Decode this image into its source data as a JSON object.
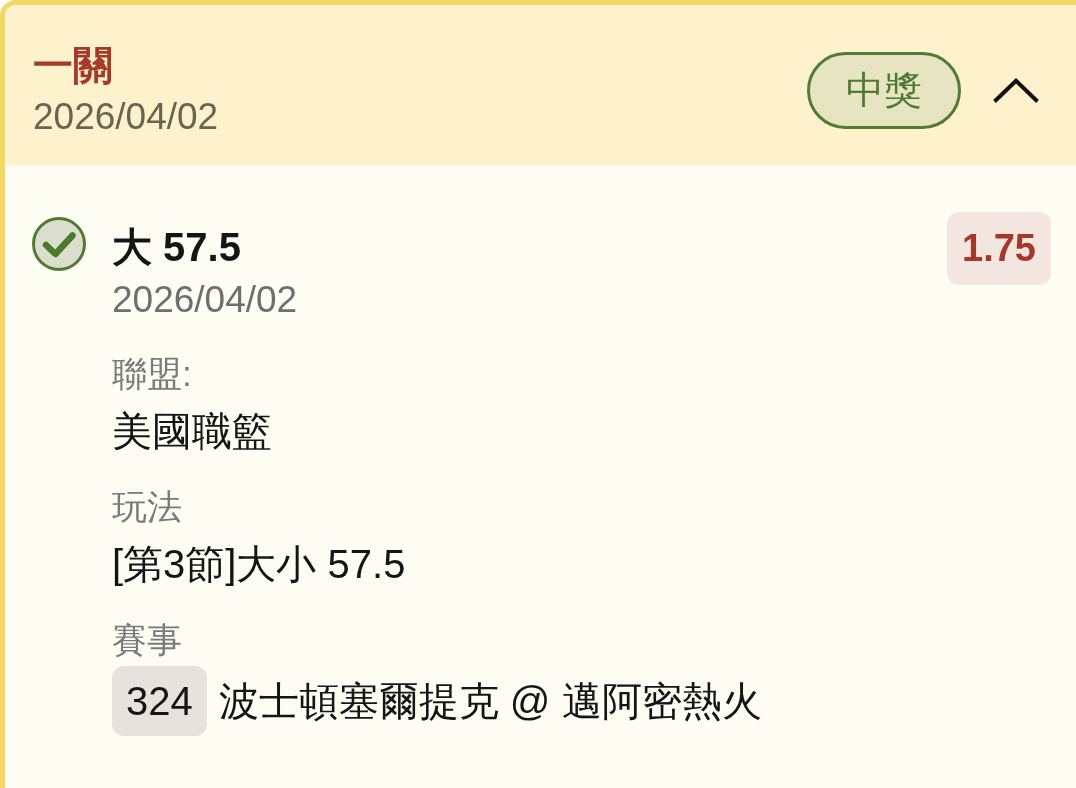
{
  "header": {
    "title": "一關",
    "date": "2026/04/02",
    "status_badge": {
      "label": "中獎",
      "kind": "won"
    },
    "expanded": true
  },
  "selections": [
    {
      "won": true,
      "title": "大 57.5",
      "date": "2026/04/02",
      "odds": "1.75",
      "fields": [
        {
          "kind": "text",
          "label": "聯盟:",
          "value": "美國職籃"
        },
        {
          "kind": "text",
          "label": "玩法",
          "value": "[第3節]大小 57.5"
        },
        {
          "kind": "match",
          "label": "賽事",
          "match_number": "324",
          "value": "波士頓塞爾提克 @ 邁阿密熱火"
        }
      ]
    }
  ]
}
